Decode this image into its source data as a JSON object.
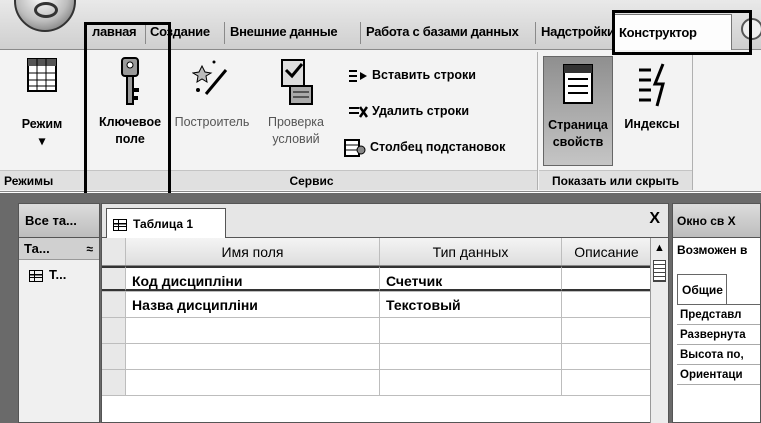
{
  "ribbon_tabs": [
    {
      "label": "лавная"
    },
    {
      "label": "Создание"
    },
    {
      "label": "Внешние данные"
    },
    {
      "label": "Работа с базами данных"
    },
    {
      "label": "Надстройки"
    },
    {
      "label": "Конструктор"
    }
  ],
  "groups": {
    "modes": {
      "label": "Режимы",
      "view_button": "Режим",
      "view_dropdown": "▾"
    },
    "tools": {
      "label": "Сервис",
      "primary_key": [
        "Ключевое",
        "поле"
      ],
      "builder": "Построитель",
      "test_rules": [
        "Проверка",
        "условий"
      ],
      "insert_rows": "Вставить строки",
      "delete_rows": "Удалить строки",
      "lookup_column": "Столбец подстановок"
    },
    "show_hide": {
      "label": "Показать или скрыть",
      "property_sheet": [
        "Страница",
        "свойств"
      ],
      "indexes": "Индексы"
    }
  },
  "nav_pane": {
    "title": "Все та...",
    "group": "Та...",
    "group_chevron": "≈",
    "item": "Т..."
  },
  "document": {
    "tab_title": "Таблица 1",
    "close": "X",
    "columns": [
      "Имя поля",
      "Тип данных",
      "Описание"
    ],
    "rows": [
      {
        "field": "Код дисципліни",
        "type": "Счетчик",
        "description": ""
      },
      {
        "field": "Назва дисципліни",
        "type": "Текстовый",
        "description": ""
      },
      {
        "field": "",
        "type": "",
        "description": ""
      },
      {
        "field": "",
        "type": "",
        "description": ""
      },
      {
        "field": "",
        "type": "",
        "description": ""
      }
    ]
  },
  "property_sheet": {
    "title": "Окно св X",
    "subtitle": "Возможен в",
    "tab": "Общие",
    "properties": [
      "Представл",
      "Развернута",
      "Высота по,",
      "Ориентаци"
    ]
  }
}
